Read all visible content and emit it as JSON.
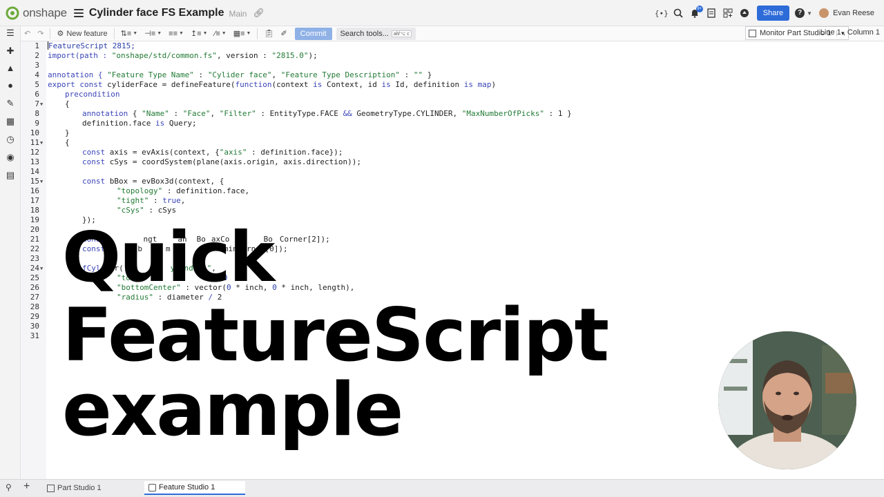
{
  "app": {
    "name": "onshape"
  },
  "document": {
    "title": "Cylinder face FS Example",
    "branch": "Main"
  },
  "header": {
    "share_label": "Share",
    "user_name": "Evan Reese",
    "notification_count": "9+",
    "icons": [
      "variable-icon",
      "search-icon",
      "notifications-icon",
      "document-icon",
      "apps-icon",
      "learning-icon",
      "help-icon"
    ]
  },
  "toolbar": {
    "new_feature_label": "New feature",
    "commit_label": "Commit",
    "search_tools_label": "Search tools...",
    "search_tools_shortcut": "alt/⌥ c",
    "monitor_label": "Monitor Part Studio 1",
    "cursor_position": "Line 1 , Column 1"
  },
  "editor": {
    "line_numbers": [
      "1",
      "2",
      "3",
      "4",
      "5",
      "6",
      "7",
      "8",
      "9",
      "10",
      "11",
      "12",
      "13",
      "14",
      "15",
      "16",
      "17",
      "18",
      "19",
      "20",
      "21",
      "22",
      "23",
      "24",
      "25",
      "26",
      "27",
      "28",
      "29",
      "30",
      "31"
    ],
    "fold_lines": [
      "7",
      "11",
      "15",
      "24"
    ],
    "code": {
      "l1": "FeatureScript 2815;",
      "l2a": "import(path : ",
      "l2b": "\"onshape/std/common.fs\"",
      "l2c": ", version : ",
      "l2d": "\"2815.0\"",
      "l2e": ");",
      "l4a": "annotation { ",
      "l4b": "\"Feature Type Name\"",
      "l4c": " : ",
      "l4d": "\"Cylider face\"",
      "l4e": ", ",
      "l4f": "\"Feature Type Description\"",
      "l4g": " : ",
      "l4h": "\"\"",
      "l4i": " }",
      "l5a": "export const",
      "l5b": " cyliderFace = defineFeature(",
      "l5c": "function",
      "l5d": "(context ",
      "l5e": "is",
      "l5f": " Context, id ",
      "l5g": "is",
      "l5h": " Id, definition ",
      "l5i": "is",
      "l5j": " ",
      "l5k": "map",
      "l5l": ")",
      "l6": "precondition",
      "l7": "{",
      "l8a": "annotation",
      "l8b": " { ",
      "l8c": "\"Name\"",
      "l8d": " : ",
      "l8e": "\"Face\"",
      "l8f": ", ",
      "l8g": "\"Filter\"",
      "l8h": " : EntityType.FACE ",
      "l8i": "&&",
      "l8j": " GeometryType.CYLINDER, ",
      "l8k": "\"MaxNumberOfPicks\"",
      "l8l": " : 1 }",
      "l9a": "definition.face ",
      "l9b": "is",
      "l9c": " Query;",
      "l10": "}",
      "l11": "{",
      "l12a": "const",
      "l12b": " axis = evAxis(context, {",
      "l12c": "\"axis\"",
      "l12d": " : definition.face});",
      "l13a": "const",
      "l13b": " cSys = coordSystem(plane(axis.origin, axis.direction));",
      "l15a": "const",
      "l15b": " bBox = evBox3d(context, {",
      "l16a": "\"topology\"",
      "l16b": " : definition.face,",
      "l17a": "\"tight\"",
      "l17b": " : ",
      "l17c": "true",
      "l17d": ",",
      "l18a": "\"cSys\"",
      "l18b": " : cSys",
      "l19": "});",
      "l21a": "cons",
      "l21b": "ngt",
      "l21c": "ah",
      "l21d": "Bo",
      "l21e": "axCo",
      "l21f": "2]",
      "l21g": "Bo",
      "l21h": "Corner[2]);",
      "l22a": "const",
      "l22b": "m",
      "l22c": "(b",
      "l22d": "m",
      "l22e": "[",
      "l22f": ".minCorner[0]);",
      "l24a": "fCyl",
      "l24b": "r(",
      "l24c": "ex",
      "l24d": "d",
      "l24e": "ylinder1\"",
      "l24f": ",",
      "l25a": "\"to",
      "l25b": "0",
      "l25c": "in",
      "l26a": "\"bottomCenter\"",
      "l26b": " : vector(",
      "l26c": "0",
      "l26d": " * inch, ",
      "l26e": "0",
      "l26f": " * inch, length),",
      "l27a": "\"radius\"",
      "l27b": " : diameter ",
      "l27c": "/",
      "l27d": " 2"
    }
  },
  "overlay": {
    "line1": "Quick",
    "line2": "FeatureScript",
    "line3": "example"
  },
  "tabs": [
    {
      "label": "Part Studio 1"
    },
    {
      "label": "Feature Studio 1"
    }
  ]
}
